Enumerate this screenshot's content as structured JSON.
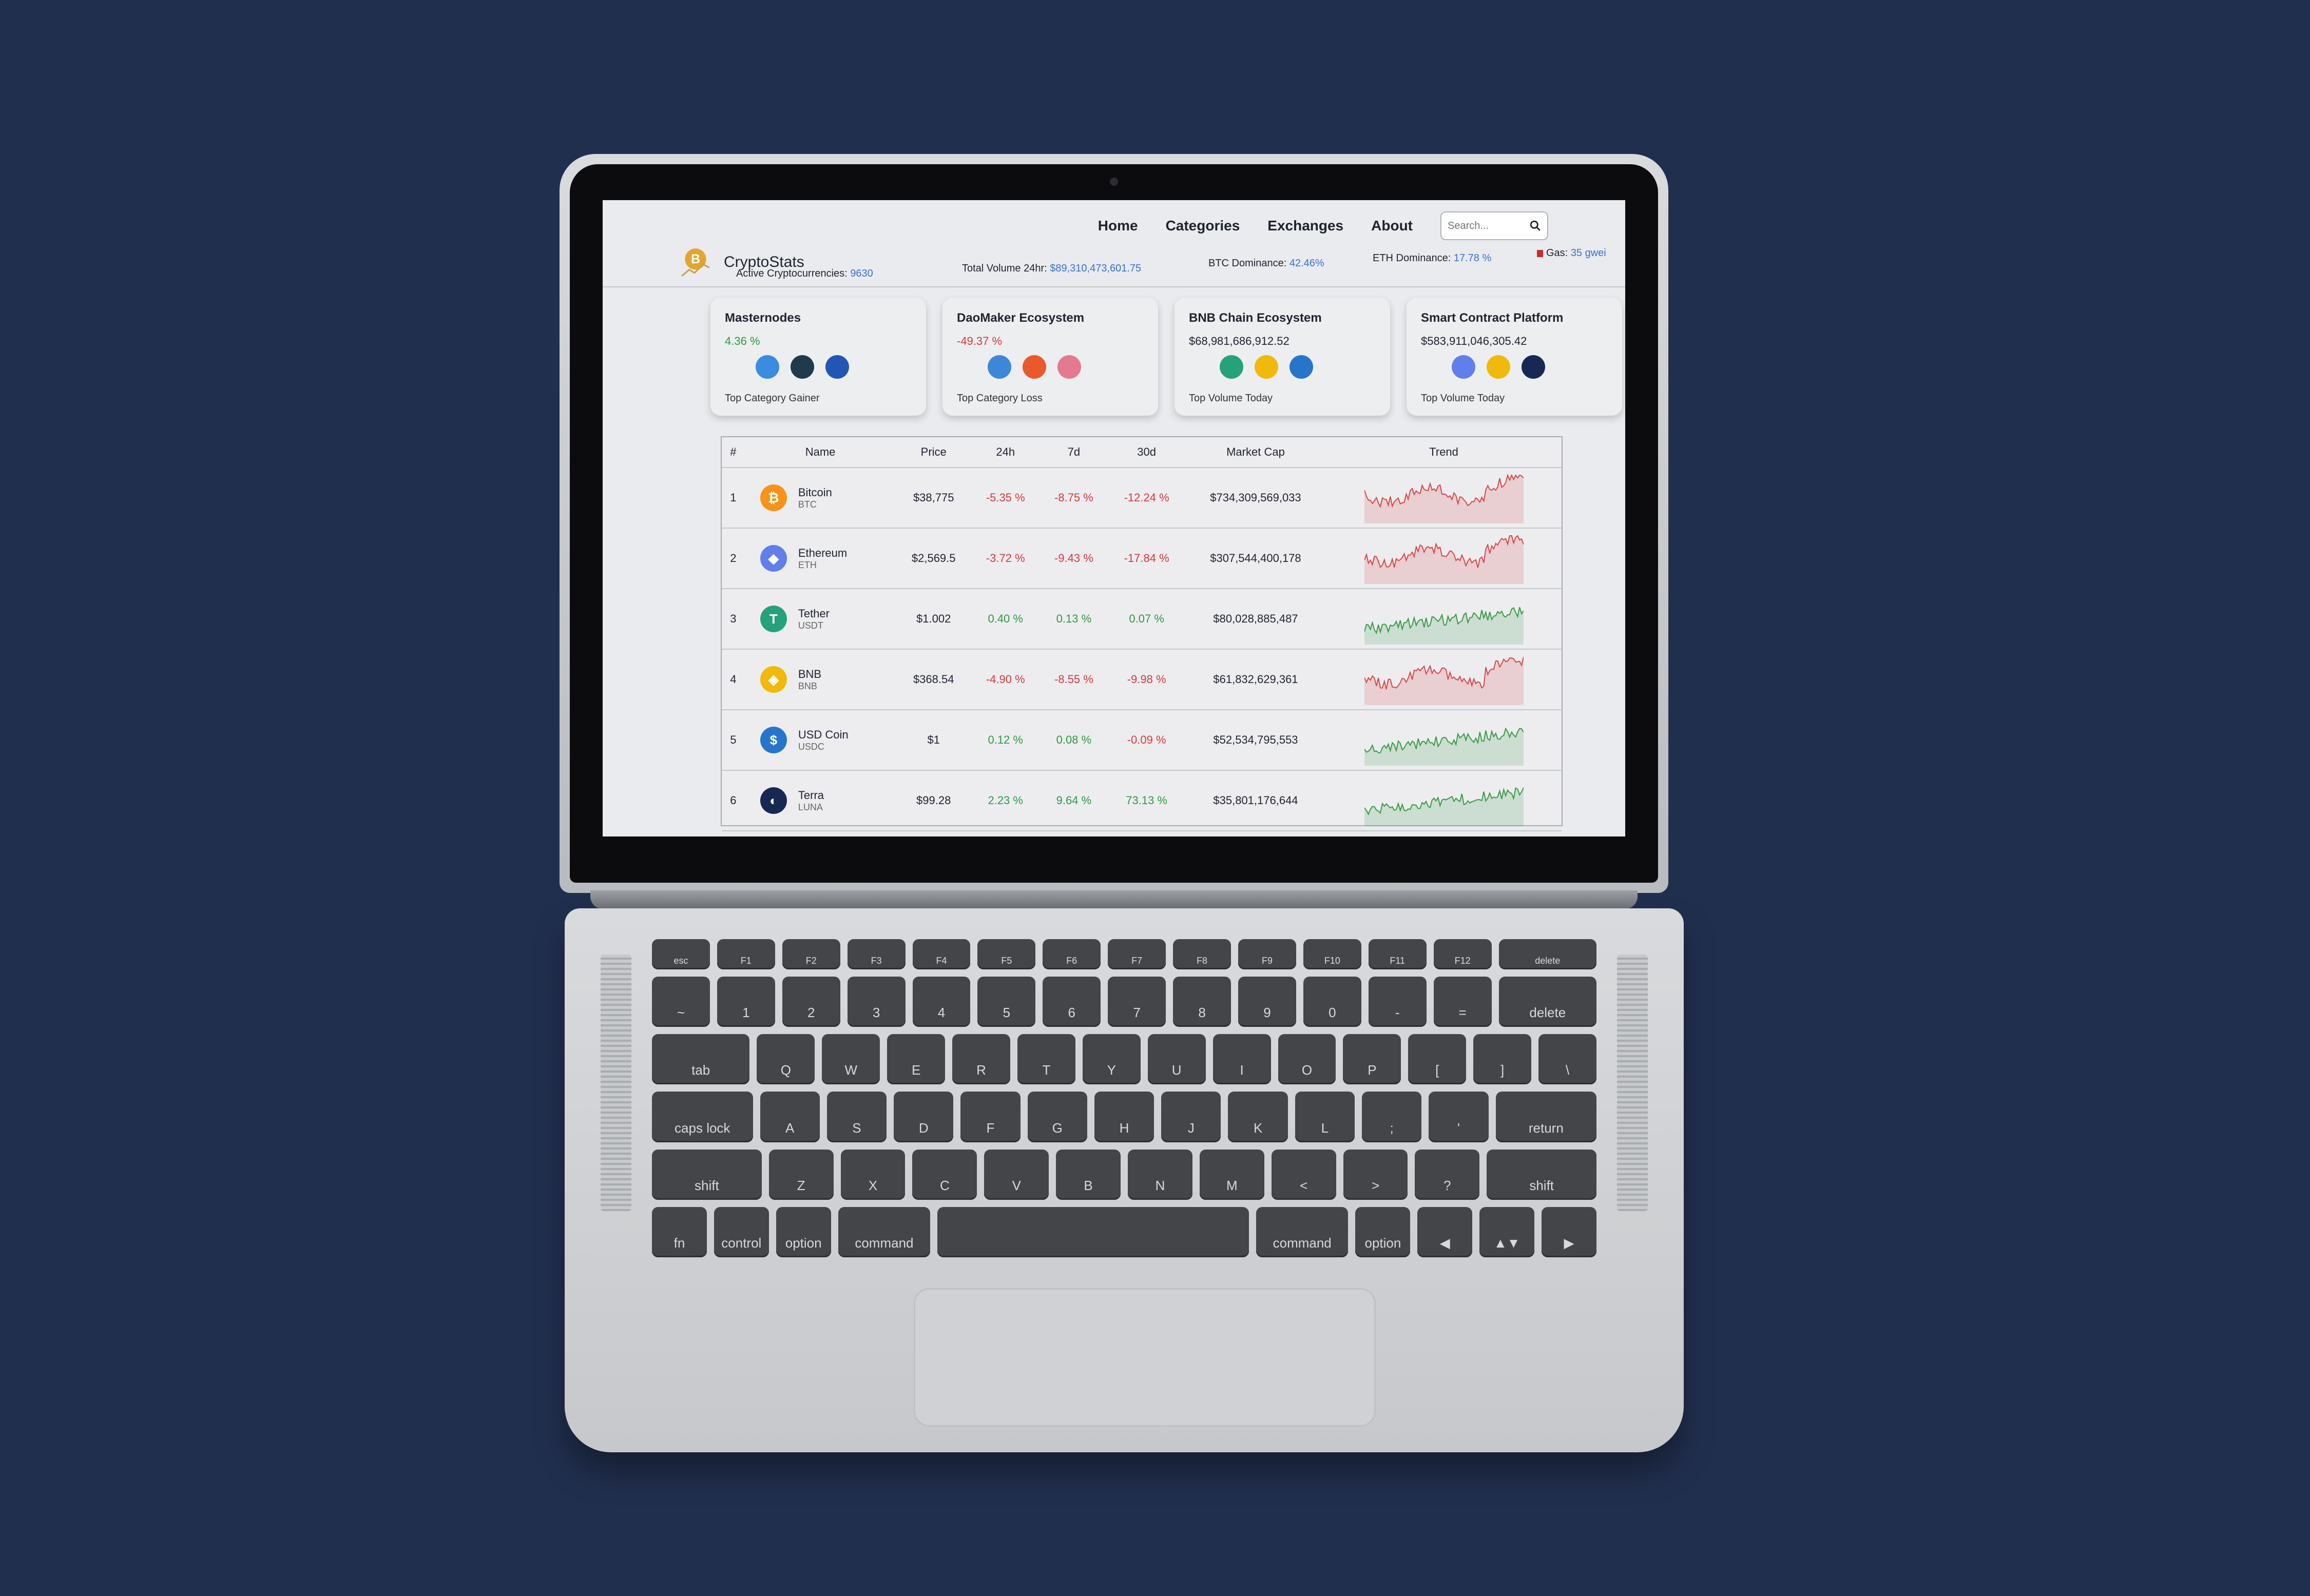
{
  "nav": {
    "home": "Home",
    "categories": "Categories",
    "exchanges": "Exchanges",
    "about": "About",
    "search_placeholder": "Search..."
  },
  "brand": {
    "name": "CryptoStats"
  },
  "stats": {
    "active_label": "Active Cryptocurrencies:",
    "active_value": "9630",
    "volume_label": "Total Volume 24hr:",
    "volume_value": "$89,310,473,601.75",
    "btc_label": "BTC Dominance:",
    "btc_value": "42.46%",
    "eth_label": "ETH Dominance:",
    "eth_value": "17.78 %",
    "gas_label": "Gas:",
    "gas_value": "35 gwei"
  },
  "cards": [
    {
      "title": "Masternodes",
      "value": "4.36 %",
      "foot": "Top Category Gainer",
      "icons": [
        "dash-coin-icon",
        "ring-coin-icon",
        "blue-coin-icon"
      ],
      "colors": [
        "#3b8be0",
        "#1f3a4d",
        "#2256b5"
      ]
    },
    {
      "title": "DaoMaker Ecosystem",
      "value": "-49.37 %",
      "foot": "Top Category Loss",
      "icons": [
        "bird-coin-icon",
        "orbit-coin-icon",
        "flower-coin-icon"
      ],
      "colors": [
        "#3d87d9",
        "#e85a2c",
        "#e37a90"
      ]
    },
    {
      "title": "BNB Chain Ecosystem",
      "value": "$68,981,686,912.52",
      "foot": "Top Volume Today",
      "icons": [
        "tether-icon",
        "bnb-icon",
        "usdc-icon"
      ],
      "colors": [
        "#26a17b",
        "#f0b90b",
        "#2775ca"
      ]
    },
    {
      "title": "Smart Contract Platform",
      "value": "$583,911,046,305.42",
      "foot": "Top Volume Today",
      "icons": [
        "ethereum-icon",
        "bnb-icon",
        "terra-icon"
      ],
      "colors": [
        "#627eea",
        "#f0b90b",
        "#172852"
      ]
    }
  ],
  "table": {
    "headers": [
      "#",
      "Name",
      "Price",
      "24h",
      "7d",
      "30d",
      "Market Cap",
      "Trend"
    ],
    "rows": [
      {
        "rank": "1",
        "name": "Bitcoin",
        "symbol": "BTC",
        "price": "$38,775",
        "h24": "-5.35 %",
        "d7": "-8.75 %",
        "d30": "-12.24 %",
        "mcap": "$734,309,569,033",
        "icon_color": "#f7931a",
        "glyph": "₿"
      },
      {
        "rank": "2",
        "name": "Ethereum",
        "symbol": "ETH",
        "price": "$2,569.5",
        "h24": "-3.72 %",
        "d7": "-9.43 %",
        "d30": "-17.84 %",
        "mcap": "$307,544,400,178",
        "icon_color": "#627eea",
        "glyph": "◆"
      },
      {
        "rank": "3",
        "name": "Tether",
        "symbol": "USDT",
        "price": "$1.002",
        "h24": "0.40 %",
        "d7": "0.13 %",
        "d30": "0.07 %",
        "mcap": "$80,028,885,487",
        "icon_color": "#26a17b",
        "glyph": "T"
      },
      {
        "rank": "4",
        "name": "BNB",
        "symbol": "BNB",
        "price": "$368.54",
        "h24": "-4.90 %",
        "d7": "-8.55 %",
        "d30": "-9.98 %",
        "mcap": "$61,832,629,361",
        "icon_color": "#f0b90b",
        "glyph": "◈"
      },
      {
        "rank": "5",
        "name": "USD Coin",
        "symbol": "USDC",
        "price": "$1",
        "h24": "0.12 %",
        "d7": "0.08 %",
        "d30": "-0.09 %",
        "mcap": "$52,534,795,553",
        "icon_color": "#2775ca",
        "glyph": "$"
      },
      {
        "rank": "6",
        "name": "Terra",
        "symbol": "LUNA",
        "price": "$99.28",
        "h24": "2.23 %",
        "d7": "9.64 %",
        "d30": "73.13 %",
        "mcap": "$35,801,176,644",
        "icon_color": "#172852",
        "glyph": "◐"
      }
    ]
  },
  "trend_colors": {
    "down": "#d84848",
    "up": "#3a9a46"
  },
  "trends": [
    "down",
    "down",
    "up",
    "down",
    "up",
    "up"
  ],
  "keyboard": {
    "rows": [
      [
        "esc",
        "F1",
        "F2",
        "F3",
        "F4",
        "F5",
        "F6",
        "F7",
        "F8",
        "F9",
        "F10",
        "F11",
        "F12",
        "delete"
      ],
      [
        "~",
        "1",
        "2",
        "3",
        "4",
        "5",
        "6",
        "7",
        "8",
        "9",
        "0",
        "-",
        "=",
        "delete"
      ],
      [
        "tab",
        "Q",
        "W",
        "E",
        "R",
        "T",
        "Y",
        "U",
        "I",
        "O",
        "P",
        "[",
        "]",
        "\\"
      ],
      [
        "caps lock",
        "A",
        "S",
        "D",
        "F",
        "G",
        "H",
        "J",
        "K",
        "L",
        ";",
        "'",
        "return"
      ],
      [
        "shift",
        "Z",
        "X",
        "C",
        "V",
        "B",
        "N",
        "M",
        "<",
        ">",
        "?",
        "shift"
      ],
      [
        "fn",
        "control",
        "option",
        "command",
        "",
        "command",
        "option",
        "◀",
        "▲▼",
        "▶"
      ]
    ]
  }
}
